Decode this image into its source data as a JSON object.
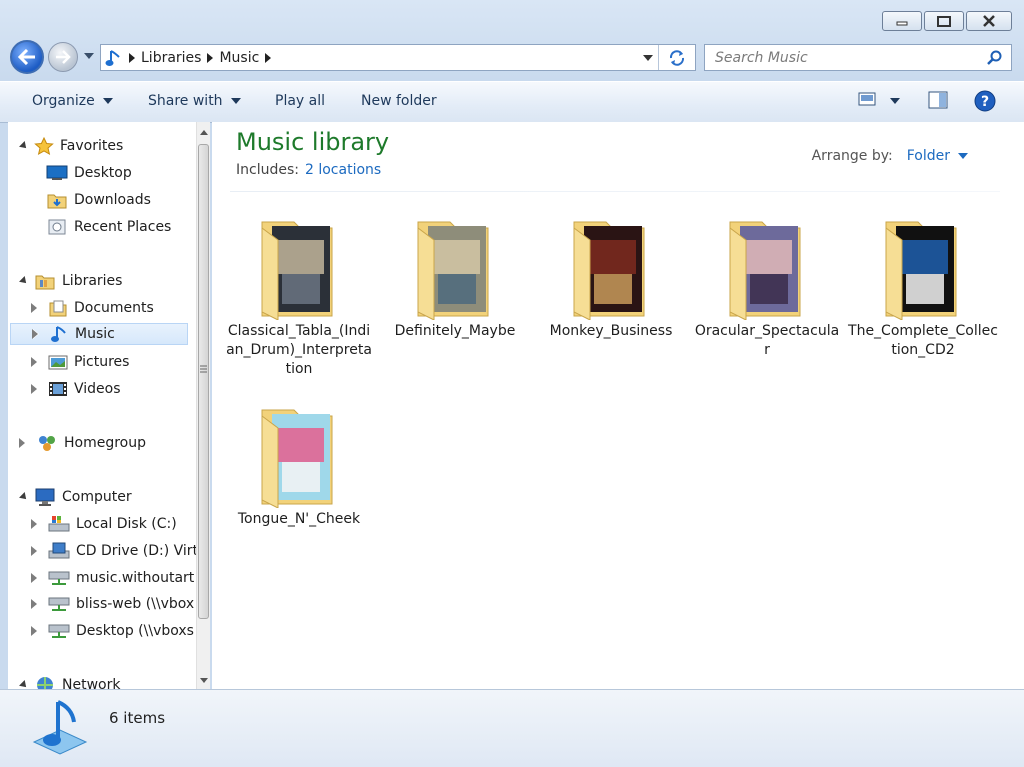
{
  "window": {
    "caption_buttons": [
      "minimize",
      "maximize",
      "close"
    ]
  },
  "address": {
    "segments": [
      "Libraries",
      "Music"
    ]
  },
  "search": {
    "placeholder": "Search Music"
  },
  "toolbar": {
    "organize": "Organize",
    "share_with": "Share with",
    "play_all": "Play all",
    "new_folder": "New folder"
  },
  "navigation": {
    "favorites": {
      "label": "Favorites",
      "items": [
        "Desktop",
        "Downloads",
        "Recent Places"
      ]
    },
    "libraries": {
      "label": "Libraries",
      "items": [
        "Documents",
        "Music",
        "Pictures",
        "Videos"
      ]
    },
    "homegroup": {
      "label": "Homegroup"
    },
    "computer": {
      "label": "Computer",
      "items": [
        "Local Disk (C:)",
        "CD Drive (D:) Virt",
        "music.withoutart",
        "bliss-web (\\\\vbox",
        "Desktop (\\\\vboxs"
      ]
    },
    "network": {
      "label": "Network"
    }
  },
  "library": {
    "title": "Music library",
    "includes_label": "Includes:",
    "includes_link": "2 locations",
    "arrange_label": "Arrange by:",
    "arrange_value": "Folder"
  },
  "folders": [
    {
      "name": "Classical_Tabla_(Indian_Drum)_Interpretation",
      "art_colors": [
        "#2b3038",
        "#c2b59b",
        "#6b7482"
      ]
    },
    {
      "name": "Definitely_Maybe",
      "art_colors": [
        "#8e8d7a",
        "#d3c7a6",
        "#4d6a7e"
      ]
    },
    {
      "name": "Monkey_Business",
      "art_colors": [
        "#2a1414",
        "#7e2a1f",
        "#c89a5b"
      ]
    },
    {
      "name": "Oracular_Spectacular",
      "art_colors": [
        "#6d6a9b",
        "#e2b8b8",
        "#3b2b4a"
      ]
    },
    {
      "name": "The_Complete_Collection_CD2",
      "art_colors": [
        "#111111",
        "#1f5fae",
        "#f2f2f2"
      ]
    },
    {
      "name": "Tongue_N'_Cheek",
      "art_colors": [
        "#9fd8ea",
        "#e55f8e",
        "#f5f5f5"
      ]
    }
  ],
  "status": {
    "count": "6 items"
  },
  "colors": {
    "title_green": "#1e7a2b",
    "link_blue": "#1c6ac0",
    "folder_yellow": "#f2d27a"
  }
}
